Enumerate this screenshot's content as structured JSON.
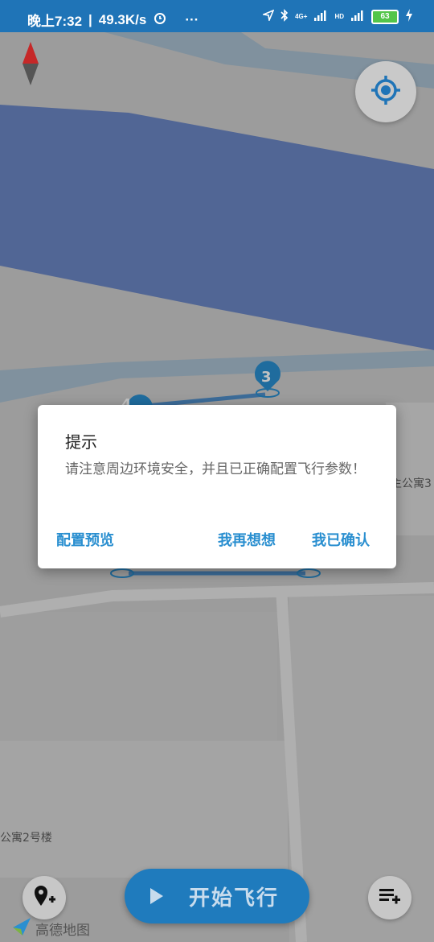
{
  "status_bar": {
    "time": "晚上7:32",
    "speed": "49.3K/s",
    "more": "···",
    "network_label": "4G+",
    "hd_label": "HD",
    "battery": "63"
  },
  "map": {
    "labels": {
      "apartment_2": "公寓2号楼",
      "apartment_3": "主公寓3"
    },
    "waypoints": [
      "3",
      "4"
    ],
    "attribution": "高德地图"
  },
  "dialog": {
    "title": "提示",
    "message": "请注意周边环境安全，并且已正确配置飞行参数！",
    "buttons": {
      "preview": "配置预览",
      "reconsider": "我再想想",
      "confirm": "我已确认"
    }
  },
  "bottom_bar": {
    "start_label": "开始飞行"
  },
  "colors": {
    "accent": "#2a8fd0",
    "status_bar": "#1f74b7",
    "water": "#6b86c4"
  }
}
